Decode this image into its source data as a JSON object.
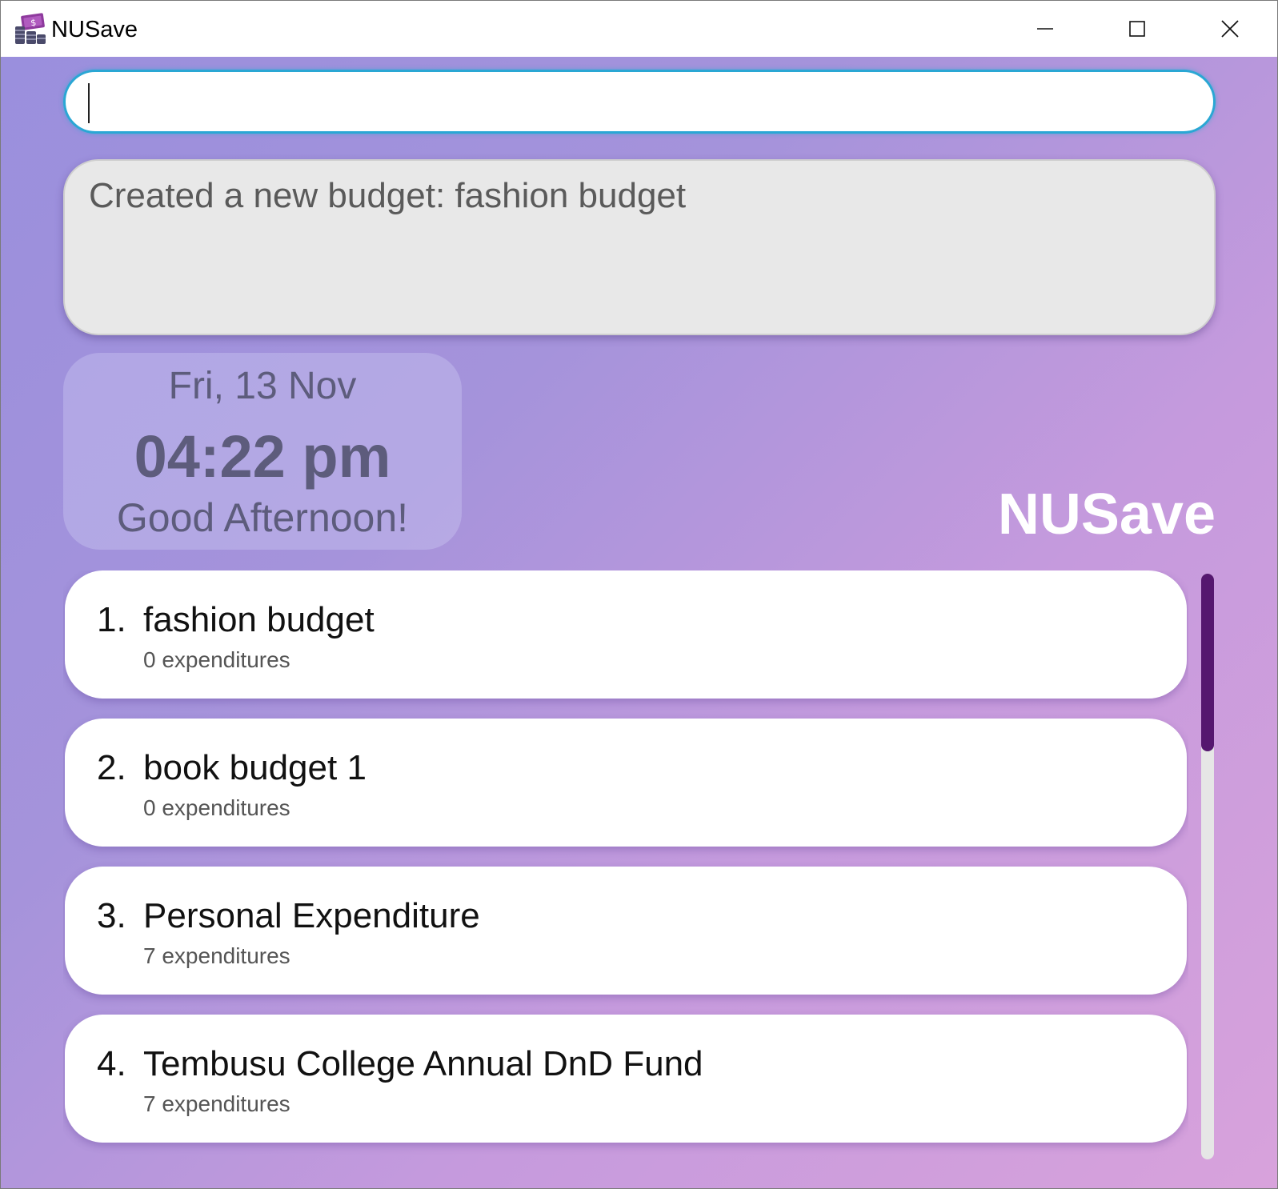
{
  "window": {
    "title": "NUSave",
    "icon": "wallet-coins-icon"
  },
  "command_box": {
    "value": "",
    "placeholder": ""
  },
  "result_display": {
    "text": "Created a new budget: fashion budget"
  },
  "clock": {
    "date": "Fri, 13 Nov",
    "time": "04:22 pm",
    "greeting": "Good Afternoon!"
  },
  "brand": {
    "label": "NUSave"
  },
  "budgets": [
    {
      "index": "1.",
      "name": "fashion budget",
      "count": "0 expenditures"
    },
    {
      "index": "2.",
      "name": "book budget 1",
      "count": "0 expenditures"
    },
    {
      "index": "3.",
      "name": "Personal Expenditure",
      "count": "7 expenditures"
    },
    {
      "index": "4.",
      "name": "Tembusu College Annual DnD Fund",
      "count": "7 expenditures"
    }
  ],
  "colors": {
    "accent_border": "#2aa7d4",
    "scroll_thumb": "#55176f",
    "background_start": "#9a8fdd",
    "background_end": "#d8a2dc"
  }
}
